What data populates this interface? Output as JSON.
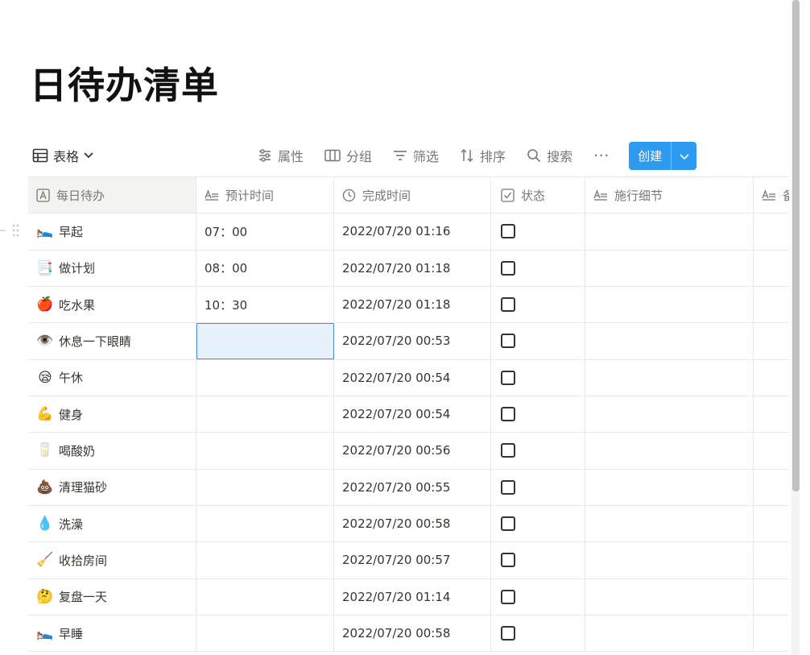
{
  "page": {
    "title": "日待办清单"
  },
  "view": {
    "label": "表格"
  },
  "toolbar": {
    "properties": "属性",
    "group": "分组",
    "filter": "筛选",
    "sort": "排序",
    "search": "搜索",
    "more": "···",
    "create": "创建"
  },
  "colors": {
    "accent": "#2e9bf0",
    "selected_cell": "#e6f1fc",
    "border": "#e9e9e7"
  },
  "table": {
    "columns": [
      "每日待办",
      "预计时间",
      "完成时间",
      "状态",
      "施行细节",
      "备"
    ],
    "rows": [
      {
        "emoji": "🛌",
        "icon": "bed-icon",
        "task": "早起",
        "planned": "07：00",
        "done": "2022/07/20 01:16",
        "status": false,
        "detail": "",
        "extra": ""
      },
      {
        "emoji": "📑",
        "icon": "bookmark-tabs-icon",
        "task": "做计划",
        "planned": "08：00",
        "done": "2022/07/20 01:18",
        "status": false,
        "detail": "",
        "extra": ""
      },
      {
        "emoji": "🍎",
        "icon": "apple-icon",
        "task": "吃水果",
        "planned": "10：30",
        "done": "2022/07/20 01:18",
        "status": false,
        "detail": "",
        "extra": ""
      },
      {
        "emoji": "👁️",
        "icon": "eye-icon",
        "task": "休息一下眼睛",
        "planned": "",
        "done": "2022/07/20 00:53",
        "status": false,
        "detail": "",
        "extra": ""
      },
      {
        "emoji": "😪",
        "icon": "sleepy-face-icon",
        "task": "午休",
        "planned": "",
        "done": "2022/07/20 00:54",
        "status": false,
        "detail": "",
        "extra": ""
      },
      {
        "emoji": "💪",
        "icon": "flexed-biceps-icon",
        "task": "健身",
        "planned": "",
        "done": "2022/07/20 00:54",
        "status": false,
        "detail": "",
        "extra": ""
      },
      {
        "emoji": "🥛",
        "icon": "milk-glass-icon",
        "task": "喝酸奶",
        "planned": "",
        "done": "2022/07/20 00:56",
        "status": false,
        "detail": "",
        "extra": ""
      },
      {
        "emoji": "💩",
        "icon": "poop-icon",
        "task": "清理猫砂",
        "planned": "",
        "done": "2022/07/20 00:55",
        "status": false,
        "detail": "",
        "extra": ""
      },
      {
        "emoji": "💧",
        "icon": "droplet-icon",
        "task": "洗澡",
        "planned": "",
        "done": "2022/07/20 00:58",
        "status": false,
        "detail": "",
        "extra": ""
      },
      {
        "emoji": "🧹",
        "icon": "broom-icon",
        "task": "收拾房间",
        "planned": "",
        "done": "2022/07/20 00:57",
        "status": false,
        "detail": "",
        "extra": ""
      },
      {
        "emoji": "🤔",
        "icon": "thinking-face-icon",
        "task": "复盘一天",
        "planned": "",
        "done": "2022/07/20 01:14",
        "status": false,
        "detail": "",
        "extra": ""
      },
      {
        "emoji": "🛌",
        "icon": "bed-icon",
        "task": "早睡",
        "planned": "",
        "done": "2022/07/20 00:58",
        "status": false,
        "detail": "",
        "extra": ""
      }
    ]
  }
}
